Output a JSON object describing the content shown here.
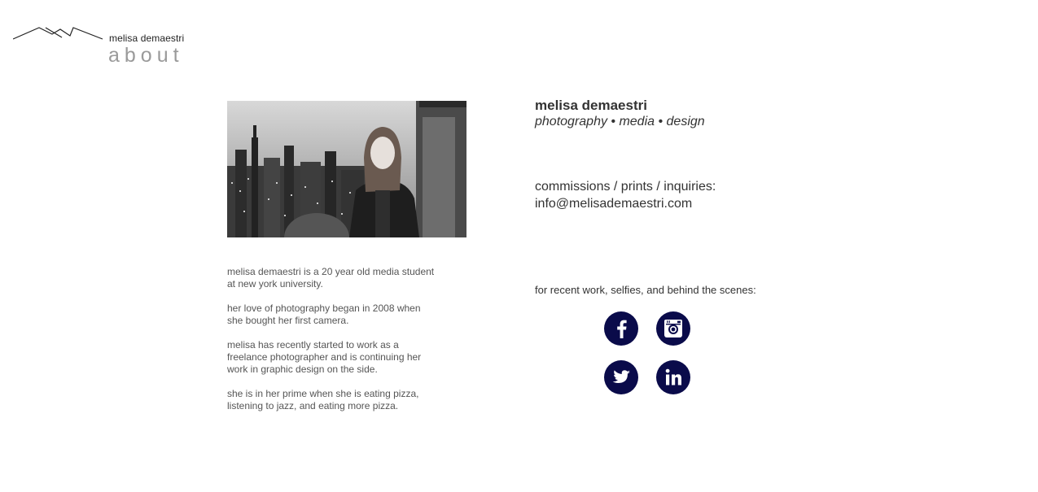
{
  "header": {
    "site_name": "melisa demaestri",
    "page_heading": "about"
  },
  "photo": {
    "alt": "black and white portrait of melisa above the city skyline"
  },
  "bio": {
    "paragraphs": [
      "melisa demaestri is a 20 year old media student at new york university.",
      "her love of photography began in 2008 when she bought her first camera.",
      "melisa has recently started to work as a freelance photographer and is continuing her work in graphic design on the side.",
      "she is in her prime when she is eating pizza, listening to jazz, and eating more pizza."
    ]
  },
  "profile": {
    "name": "melisa demaestri",
    "tagline": "photography • media • design"
  },
  "contact": {
    "label": "commissions / prints / inquiries:",
    "email": "info@melisademaestri.com"
  },
  "social": {
    "label": "for recent work, selfies, and behind the scenes:",
    "accent_color": "#0a0b4a",
    "links": [
      {
        "icon": "facebook-icon"
      },
      {
        "icon": "instagram-icon"
      },
      {
        "icon": "twitter-icon"
      },
      {
        "icon": "linkedin-icon"
      }
    ]
  }
}
